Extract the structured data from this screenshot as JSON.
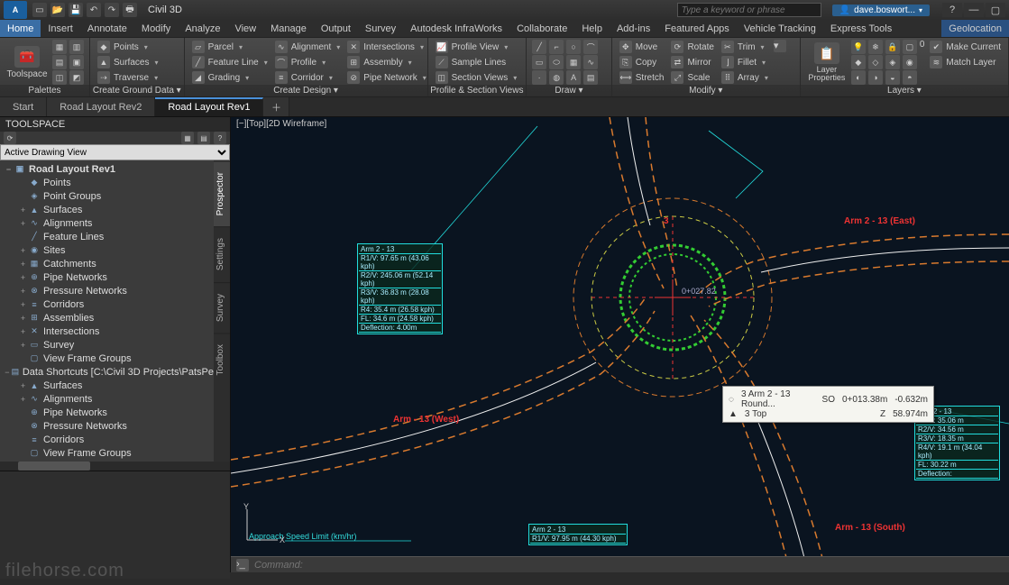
{
  "title": "Civil 3D",
  "search_placeholder": "Type a keyword or phrase",
  "user": "dave.boswort...",
  "menutabs": [
    "Home",
    "Insert",
    "Annotate",
    "Modify",
    "Analyze",
    "View",
    "Manage",
    "Output",
    "Survey",
    "Autodesk InfraWorks",
    "Collaborate",
    "Help",
    "Add-ins",
    "Featured Apps",
    "Vehicle Tracking",
    "Express Tools"
  ],
  "menutab_end": "Geolocation",
  "active_menutab": 0,
  "ribbon": {
    "palettes": {
      "label": "Palettes",
      "big": "Toolspace"
    },
    "cgd": {
      "label": "Create Ground Data ▾",
      "items": [
        "Points",
        "Surfaces",
        "Traverse"
      ]
    },
    "cd": {
      "label": "Create Design ▾",
      "c1": [
        "Parcel",
        "Feature Line",
        "Grading"
      ],
      "c2": [
        "Alignment",
        "Profile",
        "Corridor"
      ],
      "c3": [
        "Intersections",
        "Assembly",
        "Pipe Network"
      ]
    },
    "psv": {
      "label": "Profile & Section Views",
      "items": [
        "Profile View",
        "Sample Lines",
        "Section Views"
      ]
    },
    "draw": {
      "label": "Draw ▾"
    },
    "modify": {
      "label": "Modify ▾",
      "c1": [
        "Move",
        "Copy",
        "Stretch"
      ],
      "c2": [
        "Rotate",
        "Mirror",
        "Scale"
      ],
      "c3": [
        "Trim",
        "Fillet",
        "Array"
      ]
    },
    "layers": {
      "label": "Layers ▾",
      "big": "Layer Properties",
      "r": [
        "Make Current",
        "Match Layer"
      ]
    }
  },
  "doctabs": [
    "Start",
    "Road Layout Rev2",
    "Road Layout Rev1"
  ],
  "active_doctab": 2,
  "toolspace": {
    "title": "TOOLSPACE",
    "combo": "Active Drawing View",
    "vtabs": [
      "Prospector",
      "Settings",
      "Survey",
      "Toolbox"
    ],
    "tree": [
      {
        "d": 0,
        "tw": "−",
        "ic": "▣",
        "t": "Road Layout Rev1",
        "b": true
      },
      {
        "d": 1,
        "tw": "",
        "ic": "◆",
        "t": "Points"
      },
      {
        "d": 1,
        "tw": "",
        "ic": "◈",
        "t": "Point Groups"
      },
      {
        "d": 1,
        "tw": "+",
        "ic": "▲",
        "t": "Surfaces"
      },
      {
        "d": 1,
        "tw": "+",
        "ic": "∿",
        "t": "Alignments"
      },
      {
        "d": 1,
        "tw": "",
        "ic": "╱",
        "t": "Feature Lines"
      },
      {
        "d": 1,
        "tw": "+",
        "ic": "◉",
        "t": "Sites"
      },
      {
        "d": 1,
        "tw": "+",
        "ic": "▦",
        "t": "Catchments"
      },
      {
        "d": 1,
        "tw": "+",
        "ic": "⊕",
        "t": "Pipe Networks"
      },
      {
        "d": 1,
        "tw": "+",
        "ic": "⊗",
        "t": "Pressure Networks"
      },
      {
        "d": 1,
        "tw": "+",
        "ic": "≡",
        "t": "Corridors"
      },
      {
        "d": 1,
        "tw": "+",
        "ic": "⊞",
        "t": "Assemblies"
      },
      {
        "d": 1,
        "tw": "+",
        "ic": "✕",
        "t": "Intersections"
      },
      {
        "d": 1,
        "tw": "+",
        "ic": "▭",
        "t": "Survey"
      },
      {
        "d": 1,
        "tw": "",
        "ic": "▢",
        "t": "View Frame Groups"
      },
      {
        "d": 0,
        "tw": "−",
        "ic": "▤",
        "t": "Data Shortcuts [C:\\Civil 3D Projects\\PatsPe"
      },
      {
        "d": 1,
        "tw": "+",
        "ic": "▲",
        "t": "Surfaces"
      },
      {
        "d": 1,
        "tw": "+",
        "ic": "∿",
        "t": "Alignments"
      },
      {
        "d": 1,
        "tw": "",
        "ic": "⊕",
        "t": "Pipe Networks"
      },
      {
        "d": 1,
        "tw": "",
        "ic": "⊗",
        "t": "Pressure Networks"
      },
      {
        "d": 1,
        "tw": "",
        "ic": "≡",
        "t": "Corridors"
      },
      {
        "d": 1,
        "tw": "",
        "ic": "▢",
        "t": "View Frame Groups"
      }
    ]
  },
  "viewport": {
    "label": "[−][Top][2D Wireframe]",
    "tooltip": {
      "l1_name": "3 Arm 2 - 13 Round...",
      "l1_k": "SO",
      "l1_s": "0+013.38m",
      "l1_o": "-0.632m",
      "l2_name": "3 Top",
      "l2_k": "Z",
      "l2_v": "58.974m"
    },
    "labels": {
      "center": "0+027.82",
      "arm_ne": "Arm 2 - 13 (East)",
      "arm_s": "Arm - 13 (South)",
      "arm_w": "Arm - 13 (West)",
      "north": "3",
      "speed": "Approach Speed Limit (km/hr)"
    },
    "databox1": [
      "Arm 2 - 13",
      "R1/V: 97.65 m (43.06 kph)",
      "R2/V: 245.06 m (52.14 kph)",
      "R3/V: 36.83 m (28.08 kph)",
      "R4: 35.4 m (26.58 kph)",
      "FL: 34.6 m (24.58 kph)",
      "Deflection: 4.00m"
    ],
    "databox2": [
      "Arm 2 - 13",
      "R1/V: 35.06 m",
      "R2/V: 34.56 m",
      "R3/V: 18.35 m",
      "R4/V: 19.1 m (34.04 kph)",
      "FL: 30.22 m",
      "Deflection:"
    ],
    "databox3": [
      "Arm 2 - 13",
      "R1/V: 97.95 m (44.30 kph)"
    ],
    "cmd_placeholder": "Command:"
  },
  "watermark": "filehorse.com"
}
